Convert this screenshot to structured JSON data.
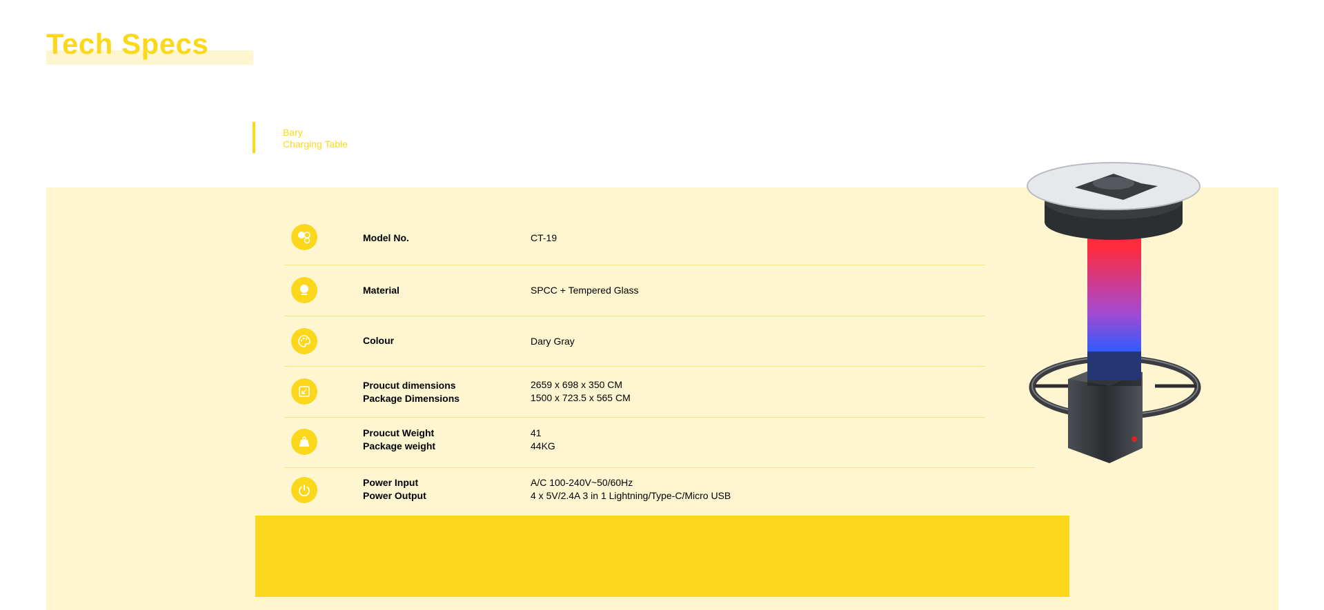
{
  "page": {
    "title": "Tech Specs",
    "brand": "Bary",
    "product_name": "Charging Table"
  },
  "specs": [
    {
      "icon": "shapes-icon",
      "label1": "Model No.",
      "value1": "CT-19"
    },
    {
      "icon": "material-icon",
      "label1": "Material",
      "value1": "SPCC + Tempered Glass"
    },
    {
      "icon": "palette-icon",
      "label1": "Colour",
      "value1": "Dary Gray"
    },
    {
      "icon": "dimensions-icon",
      "label1": "Proucut dimensions",
      "value1": "2659 x 698 x 350 CM",
      "label2": "Package Dimensions",
      "value2": "1500 x 723.5 x 565 CM"
    },
    {
      "icon": "weight-icon",
      "label1": "Proucut Weight",
      "value1": "41",
      "label2": "Package weight",
      "value2": "44KG"
    },
    {
      "icon": "power-icon",
      "label1": "Power Input",
      "value1": "A/C 100-240V~50/60Hz",
      "label2": "Power Output",
      "value2": "4 x 5V/2.4A 3 in 1 Lightning/Type-C/Micro USB"
    }
  ],
  "colors": {
    "accent": "#fcd81d",
    "panel": "#fdf6d0",
    "divider": "#f6e287"
  }
}
